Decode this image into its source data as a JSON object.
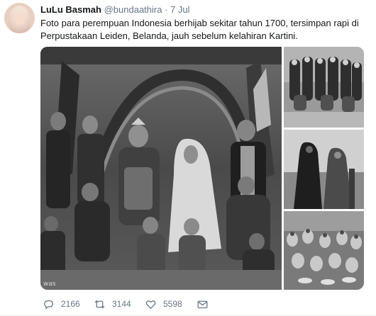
{
  "tweet": {
    "author_name": "LuLu Basmah",
    "author_handle": "@bundaathira",
    "separator": "·",
    "timestamp": "7 Jul",
    "text_line1": "Foto para perempuan Indonesia berhijab sekitar tahun 1700, tersimpan rapi di",
    "text_line2": "Perpustakaan Leiden, Belanda, jauh sebelum kelahiran Kartini.",
    "media_watermark": "was",
    "reply_count": "2166",
    "retweet_count": "3144",
    "like_count": "5598"
  },
  "icons": {
    "reply": "reply-icon",
    "retweet": "retweet-icon",
    "like": "heart-icon",
    "dm": "envelope-icon"
  },
  "colors": {
    "text": "#14171a",
    "secondary": "#657786",
    "icon": "#657786"
  }
}
